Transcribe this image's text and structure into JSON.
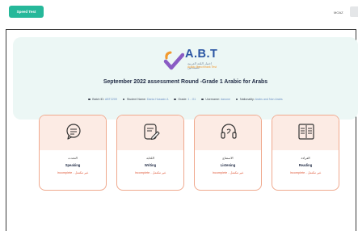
{
  "topbar": {
    "speed_test_label": "Speed Test",
    "user_name": "MOAZ"
  },
  "header": {
    "logo_text": "A.B.T",
    "logo_ar": "اختبار اللغة العربية للمبتدئين",
    "logo_en": "Arabic Benchmark Test",
    "title": "September 2022 assessment Round -Grade 1 Arabic for Arabs",
    "meta": [
      {
        "label": "Batch ID:",
        "value": "ABT2209"
      },
      {
        "label": "Student Name:",
        "value": "Dania Hussain A"
      },
      {
        "label": "Grade:",
        "value": "1 - G1"
      },
      {
        "label": "Username:",
        "value": "danone"
      },
      {
        "label": "Nationality:",
        "value": "Arabs and Non Arabs"
      }
    ]
  },
  "cards": [
    {
      "icon": "speech-bubble-icon",
      "ar": "التحدث",
      "en": "Speaking",
      "status": "Incomplete - غير مكتمل"
    },
    {
      "icon": "writing-icon",
      "ar": "الكتابة",
      "en": "Writing",
      "status": "Incomplete - غير مكتمل"
    },
    {
      "icon": "headphones-icon",
      "ar": "الاستماع",
      "en": "Listening",
      "status": "Incomplete - غير مكتمل"
    },
    {
      "icon": "book-icon",
      "ar": "القراءة",
      "en": "Reading",
      "status": "Incomplete - غير مكتمل"
    }
  ],
  "colors": {
    "accent": "#26b89a",
    "header_bg": "#ecf7f5",
    "card_border": "#f0a98e",
    "card_top": "#fcebe4",
    "status": "#e05a3a",
    "logo_blue": "#2a55a3"
  }
}
